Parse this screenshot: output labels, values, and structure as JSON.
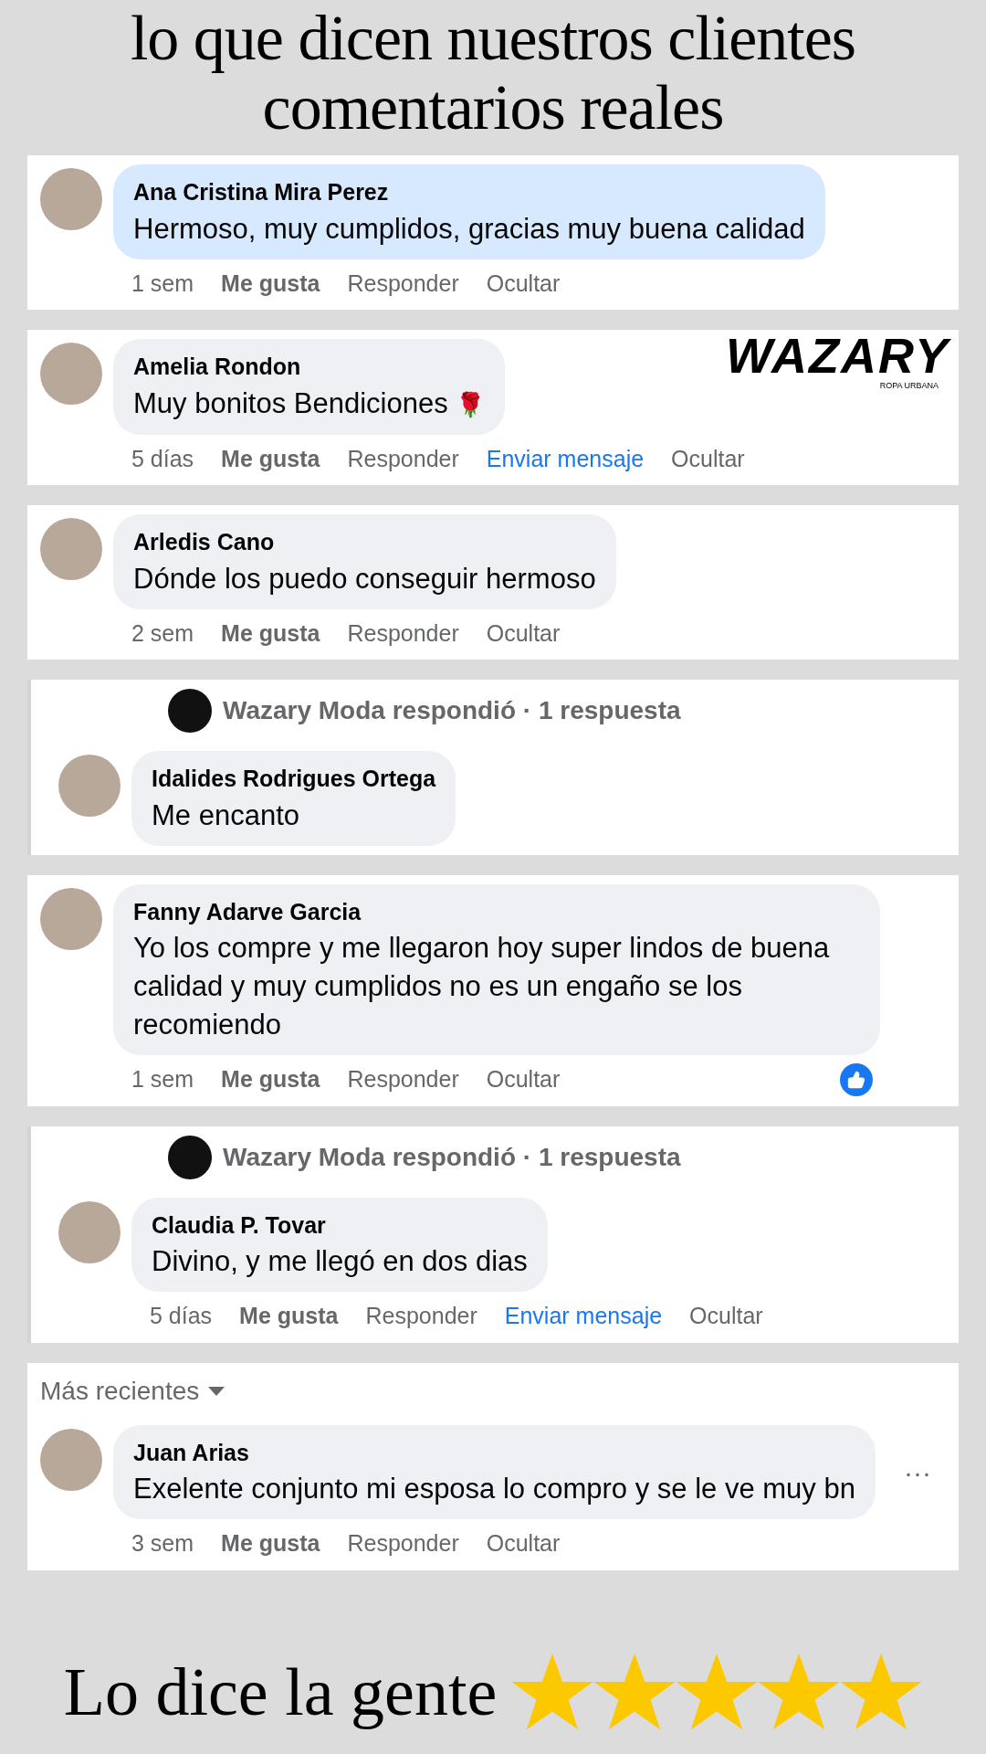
{
  "title_lines": [
    "lo que dicen nuestros clientes",
    "comentarios reales"
  ],
  "logo": {
    "name": "WAZARY",
    "tagline": "ROPA URBANA"
  },
  "cards": [
    {
      "thread": false,
      "comment": {
        "author": "Ana Cristina Mira Perez",
        "text": "Hermoso, muy cumplidos, gracias muy buena calidad",
        "highlighted": true,
        "actions": [
          {
            "kind": "time",
            "label": "1 sem"
          },
          {
            "kind": "like",
            "label": "Me gusta"
          },
          {
            "kind": "reply",
            "label": "Responder"
          },
          {
            "kind": "hide",
            "label": "Ocultar"
          }
        ]
      }
    },
    {
      "thread": false,
      "comment": {
        "author": "Amelia Rondon",
        "text": "Muy bonitos Bendiciones",
        "emoji": "🌹",
        "highlighted": false,
        "actions": [
          {
            "kind": "time",
            "label": "5 días"
          },
          {
            "kind": "like",
            "label": "Me gusta"
          },
          {
            "kind": "reply",
            "label": "Responder"
          },
          {
            "kind": "message",
            "label": "Enviar mensaje"
          },
          {
            "kind": "hide",
            "label": "Ocultar"
          }
        ]
      }
    },
    {
      "thread": false,
      "comment": {
        "author": "Arledis Cano",
        "text": "Dónde los puedo conseguir hermoso",
        "highlighted": false,
        "actions": [
          {
            "kind": "time",
            "label": "2 sem"
          },
          {
            "kind": "like",
            "label": "Me gusta"
          },
          {
            "kind": "reply",
            "label": "Responder"
          },
          {
            "kind": "hide",
            "label": "Ocultar"
          }
        ]
      }
    },
    {
      "thread": true,
      "reply_header": "Wazary Moda respondió · 1 respuesta",
      "comment": {
        "author": "Idalides Rodrigues Ortega",
        "text": "Me encanto",
        "highlighted": false
      }
    },
    {
      "thread": false,
      "comment": {
        "author": "Fanny Adarve Garcia",
        "text": "Yo los compre y me llegaron hoy super lindos de buena calidad y muy cumplidos no es un engaño se los recomiendo",
        "highlighted": false,
        "liked": true,
        "actions": [
          {
            "kind": "time",
            "label": "1 sem"
          },
          {
            "kind": "like",
            "label": "Me gusta"
          },
          {
            "kind": "reply",
            "label": "Responder"
          },
          {
            "kind": "hide",
            "label": "Ocultar"
          }
        ]
      }
    },
    {
      "thread": true,
      "reply_header": "Wazary Moda respondió · 1 respuesta",
      "comment": {
        "author": "Claudia P. Tovar",
        "text": "Divino, y me llegó en dos dias",
        "highlighted": false,
        "actions": [
          {
            "kind": "time",
            "label": "5 días"
          },
          {
            "kind": "like",
            "label": "Me gusta"
          },
          {
            "kind": "reply",
            "label": "Responder"
          },
          {
            "kind": "message",
            "label": "Enviar mensaje"
          },
          {
            "kind": "hide",
            "label": "Ocultar"
          }
        ]
      }
    },
    {
      "thread": false,
      "sort": "Más recientes",
      "comment": {
        "author": "Juan Arias",
        "text": "Exelente conjunto mi esposa lo compro y se le ve muy bn",
        "highlighted": false,
        "more": "···",
        "actions": [
          {
            "kind": "time",
            "label": "3 sem"
          },
          {
            "kind": "like",
            "label": "Me gusta"
          },
          {
            "kind": "reply",
            "label": "Responder"
          },
          {
            "kind": "hide",
            "label": "Ocultar"
          }
        ]
      }
    }
  ],
  "footer": {
    "text": "Lo dice la gente",
    "stars": 5
  }
}
